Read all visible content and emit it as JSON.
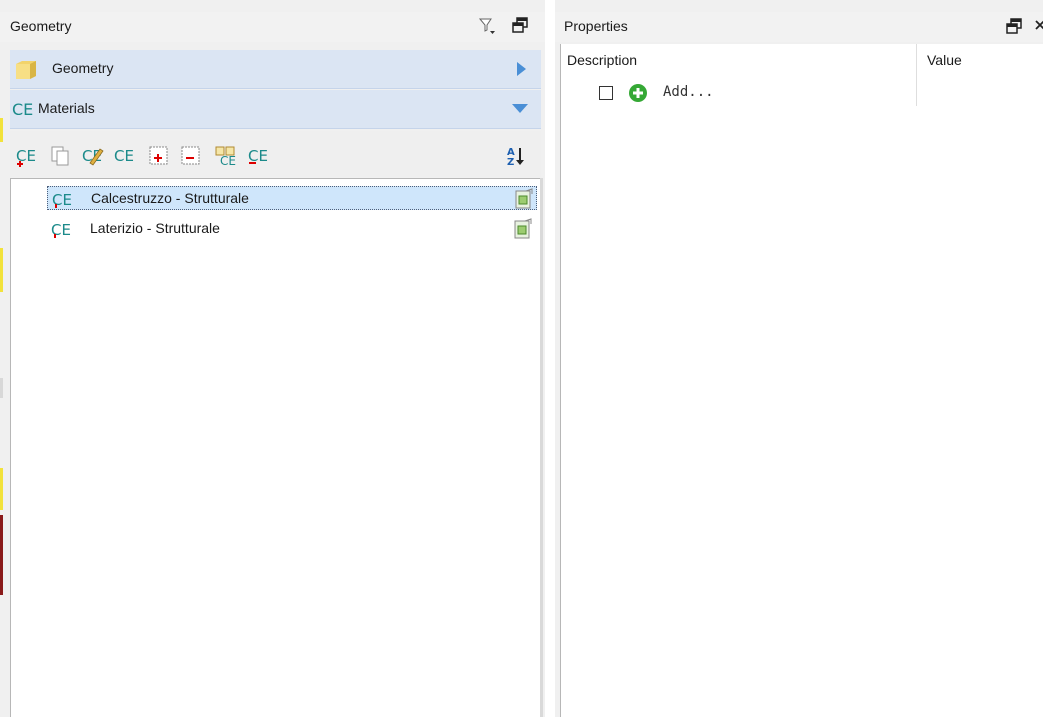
{
  "left_panel": {
    "title": "Geometry",
    "groups": [
      {
        "label": "Geometry",
        "state": "collapsed"
      },
      {
        "label": "Materials",
        "state": "expanded"
      }
    ],
    "toolbar": [
      {
        "name": "add-material-icon"
      },
      {
        "name": "copy-icon"
      },
      {
        "name": "edit-material-icon"
      },
      {
        "name": "material-icon"
      },
      {
        "name": "expand-all-icon"
      },
      {
        "name": "collapse-all-icon"
      },
      {
        "name": "material-library-icon"
      },
      {
        "name": "delete-material-icon"
      },
      {
        "name": "sort-az-icon"
      }
    ],
    "items": [
      {
        "label": "Calcestruzzo - Strutturale",
        "selected": true
      },
      {
        "label": "Laterizio - Strutturale",
        "selected": false
      }
    ]
  },
  "right_panel": {
    "title": "Properties",
    "columns": [
      "Description",
      "Value"
    ],
    "add_label": "Add..."
  },
  "colors": {
    "group_header_bg": "#dbe5f3",
    "selection_bg": "#cfe6fb",
    "material_icon_teal": "#1b8a8a",
    "add_green": "#35a835",
    "arrow_blue": "#4a8fd6"
  }
}
